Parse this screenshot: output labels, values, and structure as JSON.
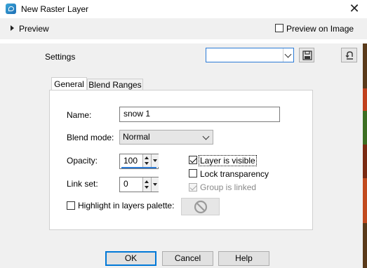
{
  "window": {
    "title": "New Raster Layer"
  },
  "preview": {
    "label": "Preview",
    "preview_on_image_label": "Preview on Image",
    "preview_on_image_checked": false
  },
  "settings": {
    "label": "Settings",
    "preset_value": ""
  },
  "tabs": [
    {
      "label": "General",
      "active": true
    },
    {
      "label": "Blend Ranges",
      "active": false
    }
  ],
  "general": {
    "name_label": "Name:",
    "name_value": "snow 1",
    "blend_mode_label": "Blend mode:",
    "blend_mode_value": "Normal",
    "opacity_label": "Opacity:",
    "opacity_value": "100",
    "link_set_label": "Link set:",
    "link_set_value": "0",
    "layer_visible_label": "Layer is visible",
    "layer_visible_checked": true,
    "lock_transparency_label": "Lock transparency",
    "lock_transparency_checked": false,
    "group_linked_label": "Group is linked",
    "group_linked_checked": true,
    "group_linked_enabled": false,
    "highlight_label": "Highlight in layers palette:",
    "highlight_checked": false
  },
  "buttons": {
    "ok": "OK",
    "cancel": "Cancel",
    "help": "Help"
  },
  "colors": {
    "accent_blue": "#0078d7",
    "opacity_bar": "#2b7bd6"
  }
}
